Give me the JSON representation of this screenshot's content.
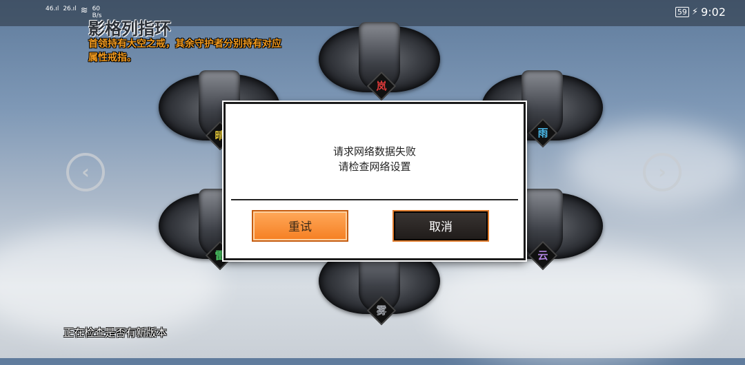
{
  "status_bar": {
    "signal1": "46",
    "signal2": "26",
    "net_speed_value": "60",
    "net_speed_unit": "B/s",
    "battery": "59",
    "time": "9:02"
  },
  "screen": {
    "title": "影格列指环",
    "subtitle": "首领持有大空之戒，其余守护者分别持有对应属性戒指。",
    "footer": "正在检查是否有新版本"
  },
  "rings": [
    {
      "name": "岚",
      "color": "#e03a3a"
    },
    {
      "name": "晴",
      "color": "#f0d23a"
    },
    {
      "name": "雨",
      "color": "#4ab8e8"
    },
    {
      "name": "雷",
      "color": "#4fd36a"
    },
    {
      "name": "云",
      "color": "#b084e0"
    },
    {
      "name": "雾",
      "color": "#9fa3aa"
    }
  ],
  "dialog": {
    "line1": "请求网络数据失败",
    "line2": "请检查网络设置",
    "retry": "重试",
    "cancel": "取消"
  },
  "icons": {
    "left_arrow": "chevron-left-icon",
    "right_arrow": "chevron-right-icon",
    "wifi": "wifi-icon",
    "charging": "charging-icon"
  }
}
